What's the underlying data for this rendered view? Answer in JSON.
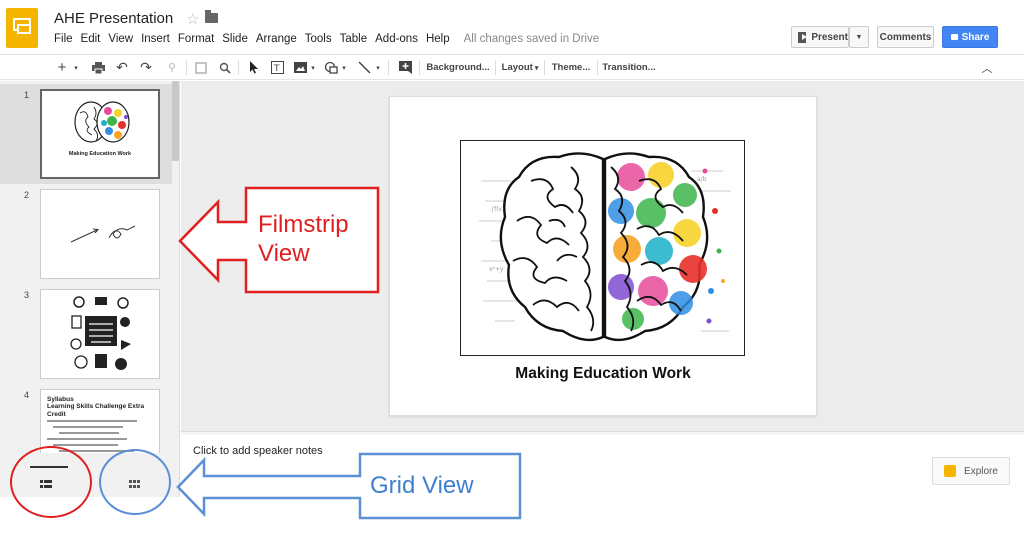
{
  "app": {
    "doc_title": "AHE Presentation",
    "menus": [
      "File",
      "Edit",
      "View",
      "Insert",
      "Format",
      "Slide",
      "Arrange",
      "Tools",
      "Table",
      "Add-ons",
      "Help"
    ],
    "save_status": "All changes saved in Drive",
    "present_label": "Present",
    "comments_label": "Comments",
    "share_label": "Share",
    "accent_color": "#4285f4",
    "logo_color": "#f4b400"
  },
  "toolbar": {
    "background_label": "Background...",
    "layout_label": "Layout",
    "theme_label": "Theme...",
    "transition_label": "Transition..."
  },
  "filmstrip": {
    "slides": [
      {
        "num": "1",
        "caption": "Making Education Work"
      },
      {
        "num": "2"
      },
      {
        "num": "3"
      },
      {
        "num": "4",
        "title_line1": "Syllabus",
        "title_line2": "Learning Skills Challenge Extra Credit"
      }
    ]
  },
  "slide": {
    "caption": "Making Education Work"
  },
  "notes": {
    "placeholder": "Click to add speaker notes"
  },
  "explore_label": "Explore",
  "annotations": {
    "filmstrip_line1": "Filmstrip",
    "filmstrip_line2": "View",
    "grid_view": "Grid View",
    "red_color": "#e02020",
    "blue_color": "#5b8fd6"
  }
}
